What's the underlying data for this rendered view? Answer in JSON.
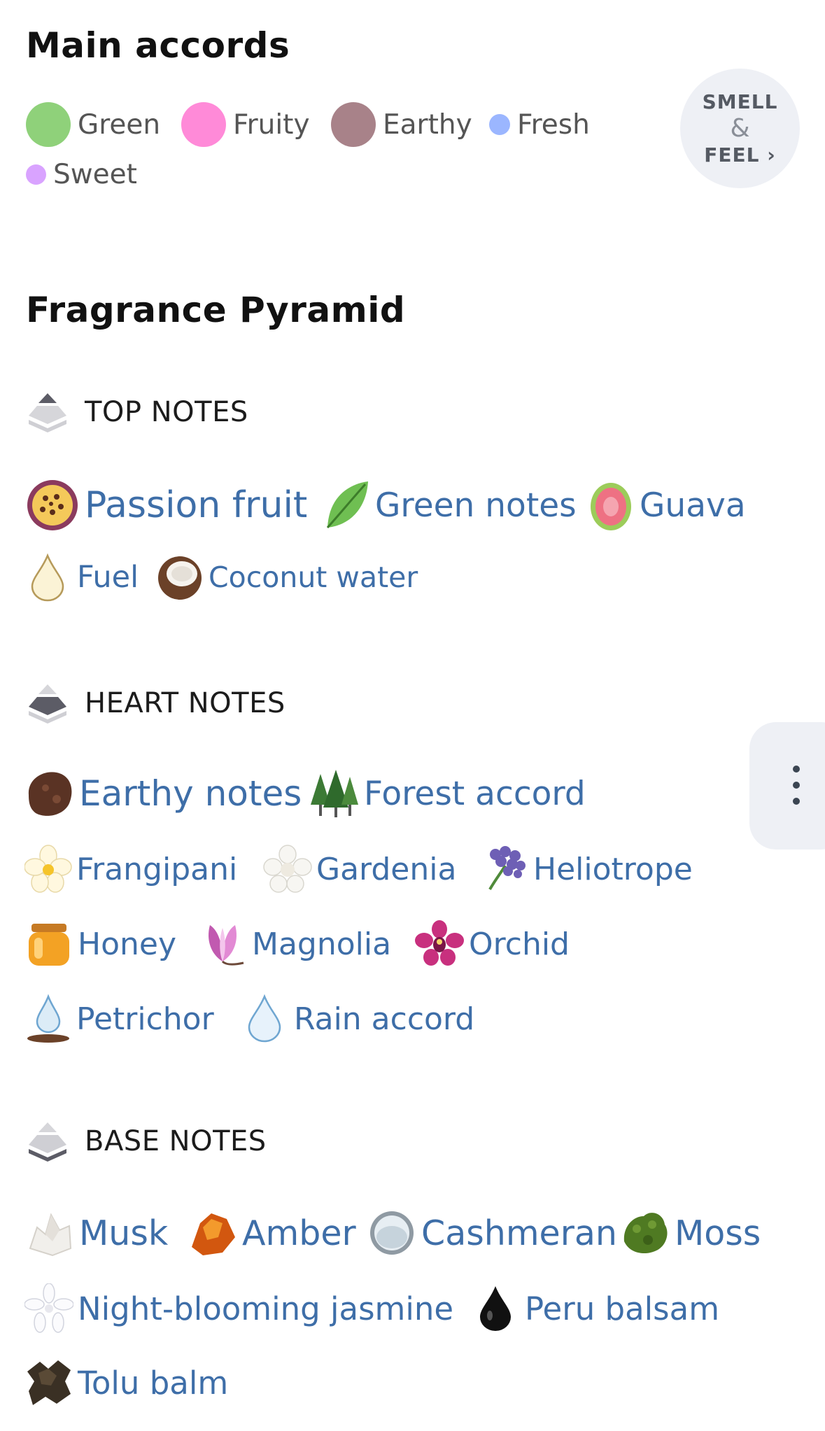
{
  "main_accords": {
    "title": "Main accords",
    "items": [
      {
        "label": "Green",
        "color": "#8fd17a"
      },
      {
        "label": "Fruity",
        "color": "#ff8ad8"
      },
      {
        "label": "Earthy",
        "color": "#a88289"
      },
      {
        "label": "Fresh",
        "color": "#9bb6ff"
      },
      {
        "label": "Sweet",
        "color": "#d9a3ff"
      }
    ],
    "smell_feel": {
      "line1": "SMELL",
      "amp": "&",
      "line2": "FEEL ›"
    }
  },
  "pyramid": {
    "title": "Fragrance Pyramid",
    "top": {
      "label": "TOP NOTES",
      "notes": [
        {
          "label": "Passion fruit",
          "icon": "passion-fruit-icon"
        },
        {
          "label": "Green notes",
          "icon": "green-leaf-icon"
        },
        {
          "label": "Guava",
          "icon": "guava-icon"
        },
        {
          "label": "Fuel",
          "icon": "fuel-drop-icon"
        },
        {
          "label": "Coconut water",
          "icon": "coconut-icon"
        }
      ]
    },
    "heart": {
      "label": "HEART NOTES",
      "notes": [
        {
          "label": "Earthy notes",
          "icon": "earth-soil-icon"
        },
        {
          "label": "Forest accord",
          "icon": "forest-trees-icon"
        },
        {
          "label": "Frangipani",
          "icon": "frangipani-flower-icon"
        },
        {
          "label": "Gardenia",
          "icon": "gardenia-flower-icon"
        },
        {
          "label": "Heliotrope",
          "icon": "heliotrope-flower-icon"
        },
        {
          "label": "Honey",
          "icon": "honey-jar-icon"
        },
        {
          "label": "Magnolia",
          "icon": "magnolia-flower-icon"
        },
        {
          "label": "Orchid",
          "icon": "orchid-flower-icon"
        },
        {
          "label": "Petrichor",
          "icon": "petrichor-drop-icon"
        },
        {
          "label": "Rain accord",
          "icon": "rain-drop-icon"
        }
      ]
    },
    "base": {
      "label": "BASE NOTES",
      "notes": [
        {
          "label": "Musk",
          "icon": "musk-crystal-icon"
        },
        {
          "label": "Amber",
          "icon": "amber-stone-icon"
        },
        {
          "label": "Cashmeran",
          "icon": "cashmeran-ring-icon"
        },
        {
          "label": "Moss",
          "icon": "moss-icon"
        },
        {
          "label": "Night-blooming jasmine",
          "icon": "jasmine-flower-icon"
        },
        {
          "label": "Peru balsam",
          "icon": "balsam-drop-icon"
        },
        {
          "label": "Tolu balm",
          "icon": "tolu-bark-icon"
        }
      ]
    }
  }
}
